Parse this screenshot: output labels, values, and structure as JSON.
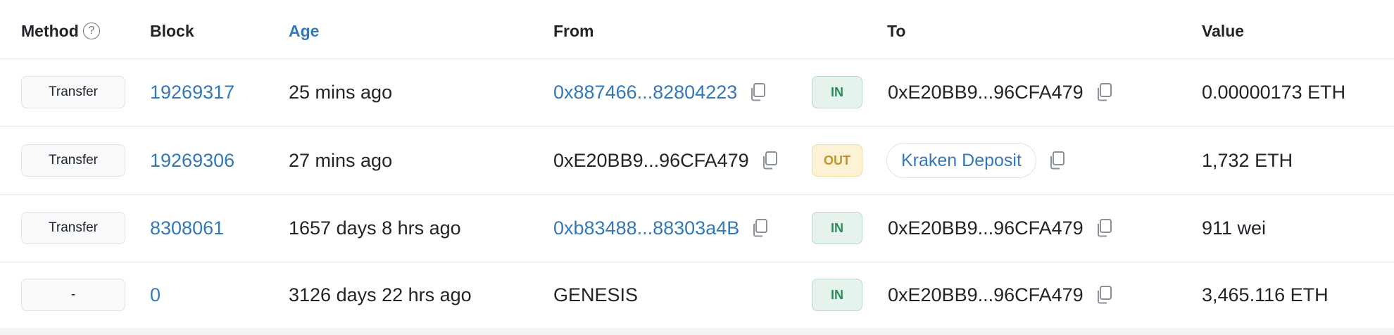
{
  "colors": {
    "link": "#3478b8",
    "text": "#212529",
    "in_badge_bg": "#e6f2ec",
    "in_badge_text": "#2f8a5b",
    "out_badge_bg": "#fdf2d3",
    "out_badge_text": "#c2922a"
  },
  "header": {
    "method": "Method",
    "help_symbol": "?",
    "block": "Block",
    "age": "Age",
    "from": "From",
    "to": "To",
    "value": "Value"
  },
  "rows": [
    {
      "method": "Transfer",
      "block": "19269317",
      "age": "25 mins ago",
      "from": "0x887466...82804223",
      "direction": "IN",
      "to": "0xE20BB9...96CFA479",
      "value": "0.00000173 ETH"
    },
    {
      "method": "Transfer",
      "block": "19269306",
      "age": "27 mins ago",
      "from": "0xE20BB9...96CFA479",
      "direction": "OUT",
      "to": "Kraken Deposit",
      "value": "1,732 ETH"
    },
    {
      "method": "Transfer",
      "block": "8308061",
      "age": "1657 days 8 hrs ago",
      "from": "0xb83488...88303a4B",
      "direction": "IN",
      "to": "0xE20BB9...96CFA479",
      "value": "911 wei"
    },
    {
      "method": "-",
      "block": "0",
      "age": "3126 days 22 hrs ago",
      "from": "GENESIS",
      "direction": "IN",
      "to": "0xE20BB9...96CFA479",
      "value": "3,465.116 ETH"
    }
  ]
}
